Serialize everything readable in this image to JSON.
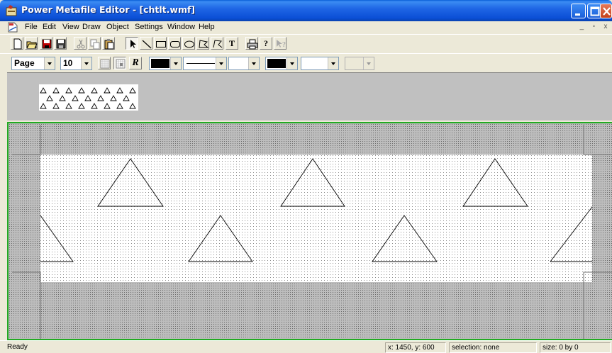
{
  "window": {
    "title": "Power Metafile Editor - [chtlt.wmf]"
  },
  "menu": {
    "items": [
      "File",
      "Edit",
      "View",
      "Draw",
      "Object",
      "Settings",
      "Window",
      "Help"
    ],
    "mdi_buttons": [
      "_",
      "▫",
      "x"
    ]
  },
  "toolbar": {
    "buttons": [
      "new",
      "open",
      "save",
      "save-floppy",
      "cut",
      "copy",
      "paste",
      "select-arrow",
      "line",
      "rectangle",
      "rounded-rectangle",
      "ellipse",
      "polygon",
      "polyline",
      "text",
      "print",
      "help",
      "context-help"
    ],
    "text_tool_glyph": "T",
    "help_glyph": "?"
  },
  "format_bar": {
    "units_value": "Page",
    "size_value": "10",
    "rotate_glyph": "R",
    "pen_color": "#000000",
    "brush_color": "#000000"
  },
  "status": {
    "ready": "Ready",
    "coords": "x: 1450, y: 600",
    "selection": "selection: none",
    "size": "size: 0 by 0"
  },
  "colors": {
    "titlebar": "#0b4fd6",
    "canvas_border": "#22aa22",
    "canvas_bg": "#b4b4b4",
    "paper": "#ffffff"
  },
  "icons": [
    "app-icon",
    "minimize-icon",
    "maximize-icon",
    "close-icon",
    "document-icon"
  ]
}
